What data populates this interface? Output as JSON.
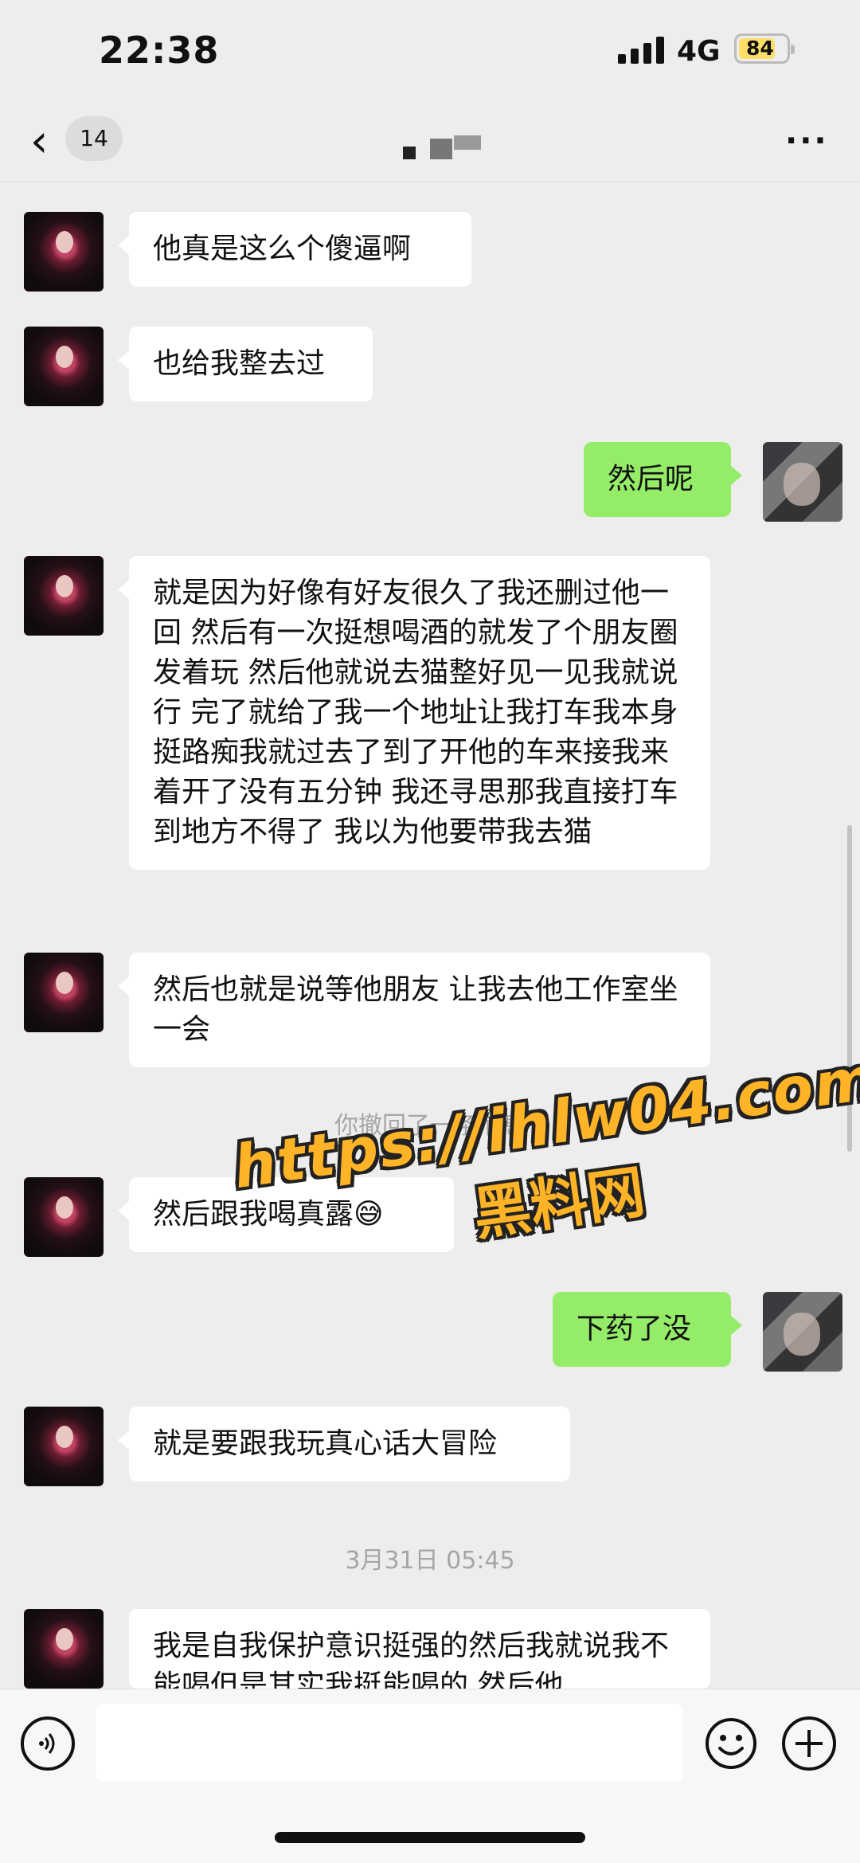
{
  "status": {
    "time": "22:38",
    "network": "4G",
    "battery": "84"
  },
  "nav": {
    "unread_count": "14",
    "back_icon": "chevron-left-icon",
    "more_icon": "more-dots-icon"
  },
  "messages": [
    {
      "side": "left",
      "text": "他真是这么个傻逼啊"
    },
    {
      "side": "left",
      "text": "也给我整去过"
    },
    {
      "side": "right",
      "text": "然后呢"
    },
    {
      "side": "left",
      "text": "就是因为好像有好友很久了我还删过他一回 然后有一次挺想喝酒的就发了个朋友圈发着玩 然后他就说去猫整好见一见我就说行 完了就给了我一个地址让我打车我本身挺路痴我就过去了到了开他的车来接我来着开了没有五分钟 我还寻思那我直接打车到地方不得了 我以为他要带我去猫"
    },
    {
      "side": "left",
      "text": "然后也就是说等他朋友 让我去他工作室坐一会"
    },
    {
      "side": "system",
      "text": "你撤回了一条消息"
    },
    {
      "side": "left",
      "text": "然后跟我喝真露😅"
    },
    {
      "side": "right",
      "text": "下药了没"
    },
    {
      "side": "left",
      "text": "就是要跟我玩真心话大冒险"
    },
    {
      "side": "system",
      "text": "3月31日 05:45"
    },
    {
      "side": "left",
      "text": "我是自我保护意识挺强的然后我就说我不能喝但是其实我挺能喝的 然后他"
    }
  ],
  "watermark": {
    "url": "https://ihlw04.com",
    "site": "黑料网"
  },
  "input": {
    "voice_icon": "voice-icon",
    "emoji_icon": "emoji-icon",
    "plus_icon": "plus-icon"
  }
}
